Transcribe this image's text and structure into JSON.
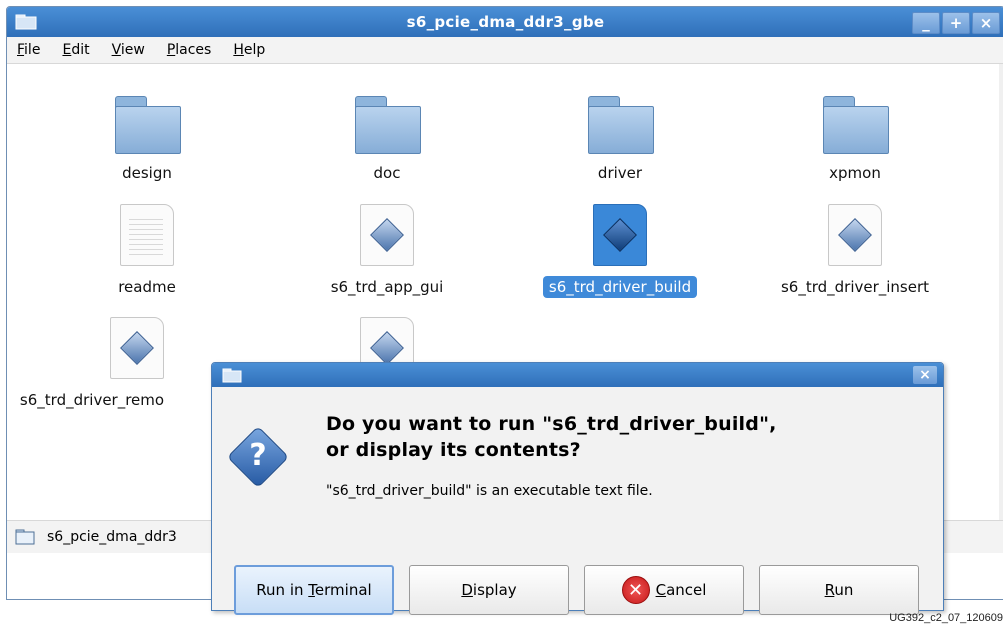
{
  "window": {
    "title": "s6_pcie_dma_ddr3_gbe",
    "controls": [
      "_",
      "+",
      "×"
    ]
  },
  "menu": [
    {
      "label": "File",
      "mnemonic": "F",
      "rest": "ile"
    },
    {
      "label": "Edit",
      "mnemonic": "E",
      "rest": "dit"
    },
    {
      "label": "View",
      "mnemonic": "V",
      "rest": "iew"
    },
    {
      "label": "Places",
      "mnemonic": "P",
      "rest": "laces"
    },
    {
      "label": "Help",
      "mnemonic": "H",
      "rest": "elp"
    }
  ],
  "files": [
    {
      "name": "design",
      "type": "folder"
    },
    {
      "name": "doc",
      "type": "folder"
    },
    {
      "name": "driver",
      "type": "folder"
    },
    {
      "name": "xpmon",
      "type": "folder"
    },
    {
      "name": "readme",
      "type": "text"
    },
    {
      "name": "s6_trd_app_gui",
      "type": "script"
    },
    {
      "name": "s6_trd_driver_build",
      "type": "script",
      "selected": true
    },
    {
      "name": "s6_trd_driver_insert",
      "type": "script"
    },
    {
      "name": "s6_trd_driver_remo",
      "type": "script"
    },
    {
      "name": "",
      "type": "script"
    }
  ],
  "statusbar": {
    "text": "s6_pcie_dma_ddr3"
  },
  "dialog": {
    "close": "×",
    "heading_line1": "Do you want to run \"s6_trd_driver_build\",",
    "heading_line2": "or display its contents?",
    "subtext": "\"s6_trd_driver_build\" is an executable text file.",
    "buttons": {
      "run_in_terminal": {
        "pre": "Run in ",
        "mnemonic": "T",
        "post": "erminal"
      },
      "display": {
        "pre": "",
        "mnemonic": "D",
        "post": "isplay"
      },
      "cancel": {
        "pre": "",
        "mnemonic": "C",
        "post": "ancel"
      },
      "run": {
        "pre": "",
        "mnemonic": "R",
        "post": "un"
      }
    }
  },
  "caption": "UG392_c2_07_120609",
  "colors": {
    "titlebar": "#2f6fb9",
    "selection": "#3f8ad9",
    "cancel": "#c61818"
  }
}
